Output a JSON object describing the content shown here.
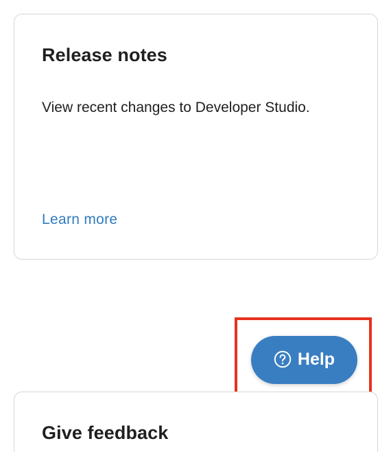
{
  "release_card": {
    "title": "Release notes",
    "description": "View recent changes to Developer Studio.",
    "link_label": "Learn more"
  },
  "help_button": {
    "label": "Help",
    "icon": "question-circle-icon"
  },
  "feedback_card": {
    "title": "Give feedback"
  },
  "colors": {
    "link": "#2f7bbf",
    "help_button_bg": "#3a7ec2",
    "highlight": "#e5321f"
  }
}
